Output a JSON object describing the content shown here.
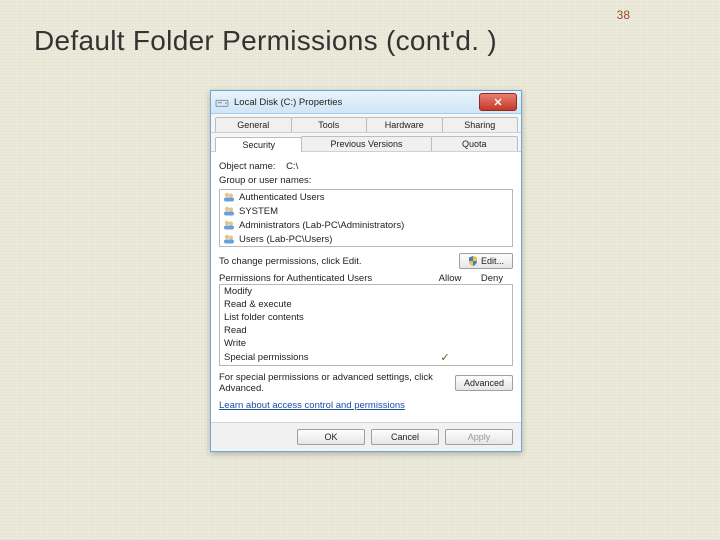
{
  "slide": {
    "number": "38",
    "title": "Default Folder Permissions (cont'd. )"
  },
  "dialog": {
    "title": "Local Disk (C:) Properties",
    "tabs": {
      "row1": [
        "General",
        "Tools",
        "Hardware",
        "Sharing"
      ],
      "row2": [
        "Security",
        "Previous Versions",
        "Quota"
      ]
    },
    "object_label": "Object name:",
    "object_value": "C:\\",
    "group_label": "Group or user names:",
    "users": [
      "Authenticated Users",
      "SYSTEM",
      "Administrators (Lab-PC\\Administrators)",
      "Users (Lab-PC\\Users)"
    ],
    "edit_hint": "To change permissions, click Edit.",
    "edit_btn": "Edit...",
    "perm_for": "Permissions for Authenticated Users",
    "allow": "Allow",
    "deny": "Deny",
    "perms": [
      "Modify",
      "Read & execute",
      "List folder contents",
      "Read",
      "Write",
      "Special permissions"
    ],
    "special_tick_index": 5,
    "adv_hint": "For special permissions or advanced settings, click Advanced.",
    "adv_btn": "Advanced",
    "learn_link": "Learn about access control and permissions",
    "buttons": {
      "ok": "OK",
      "cancel": "Cancel",
      "apply": "Apply"
    }
  }
}
